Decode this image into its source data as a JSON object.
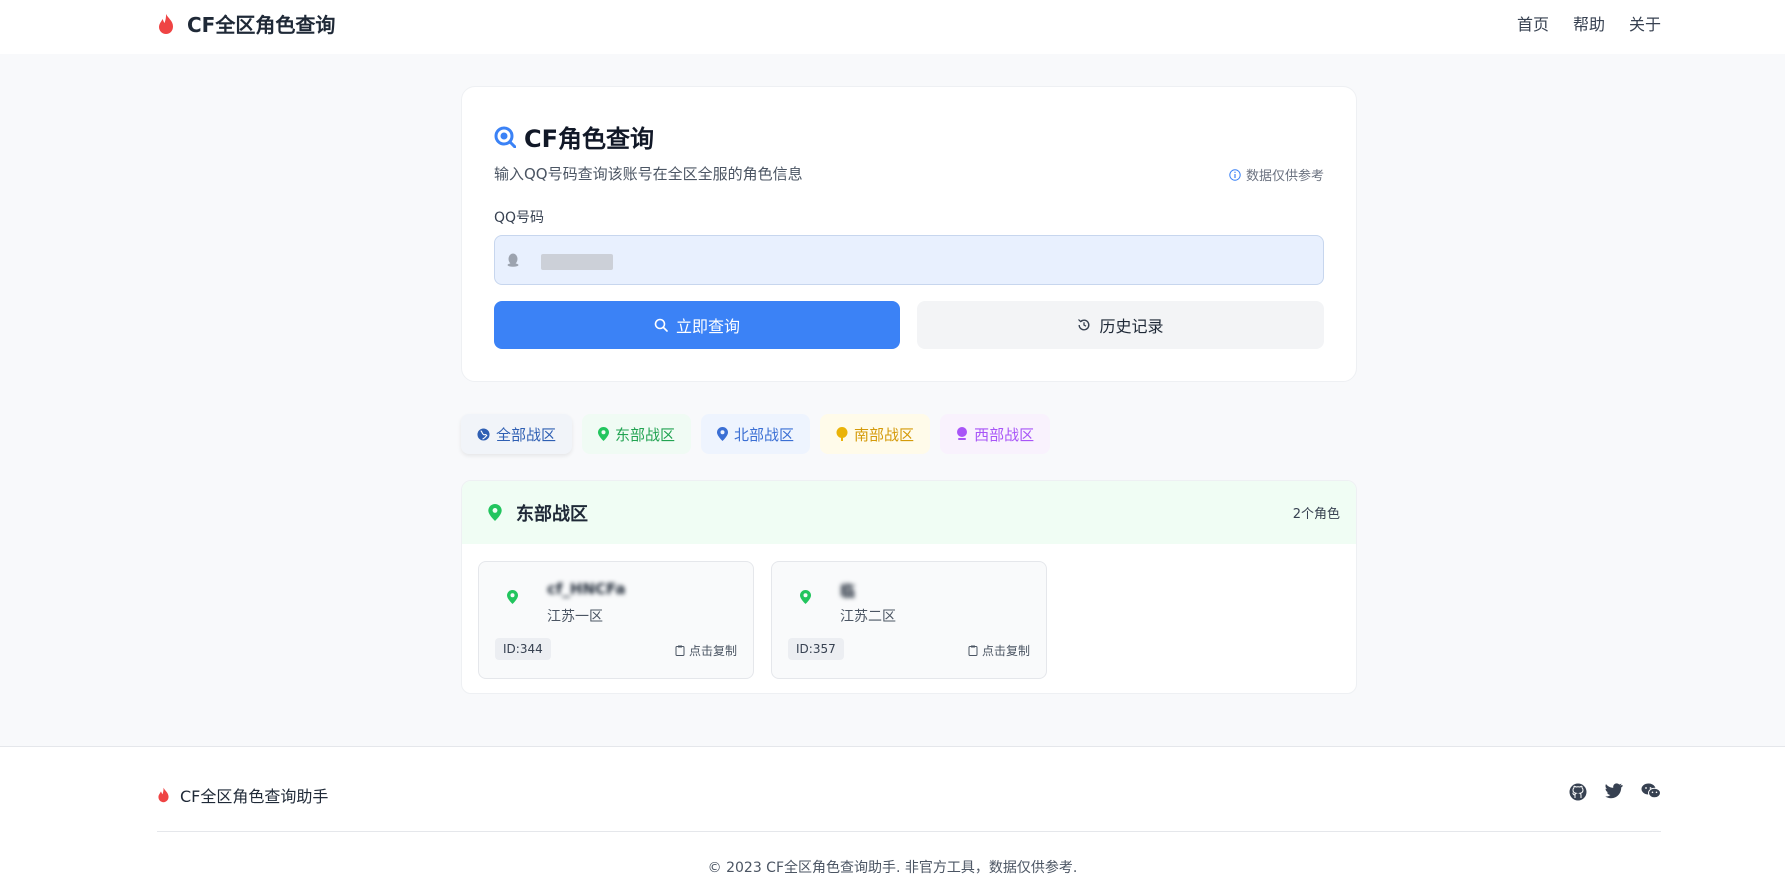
{
  "header": {
    "brand": "CF全区角色查询",
    "nav": [
      "首页",
      "帮助",
      "关于"
    ]
  },
  "search_card": {
    "title": "CF角色查询",
    "subtitle": "输入QQ号码查询该账号在全区全服的角色信息",
    "note": "数据仅供参考",
    "field_label": "QQ号码",
    "input_value": "",
    "query_button": "立即查询",
    "history_button": "历史记录"
  },
  "tabs": [
    {
      "label": "全部战区",
      "color": "#2f5fb3"
    },
    {
      "label": "东部战区",
      "color": "#22a352"
    },
    {
      "label": "北部战区",
      "color": "#3b6fd4"
    },
    {
      "label": "南部战区",
      "color": "#d49a0a"
    },
    {
      "label": "西部战区",
      "color": "#a855f7"
    }
  ],
  "region": {
    "name": "东部战区",
    "count": "2个角色",
    "roles": [
      {
        "name": "cf_HNCFa",
        "server": "江苏一区",
        "id": "ID:344",
        "copy": "点击复制"
      },
      {
        "name": "临",
        "server": "江苏二区",
        "id": "ID:357",
        "copy": "点击复制"
      }
    ]
  },
  "footer": {
    "brand": "CF全区角色查询助手",
    "copyright": "© 2023 CF全区角色查询助手. 非官方工具，数据仅供参考.",
    "social_icons": [
      "github-icon",
      "twitter-icon",
      "wechat-icon"
    ]
  },
  "colors": {
    "primary": "#3b82f6",
    "flame": "#ef4444",
    "east_green": "#22c55e"
  }
}
